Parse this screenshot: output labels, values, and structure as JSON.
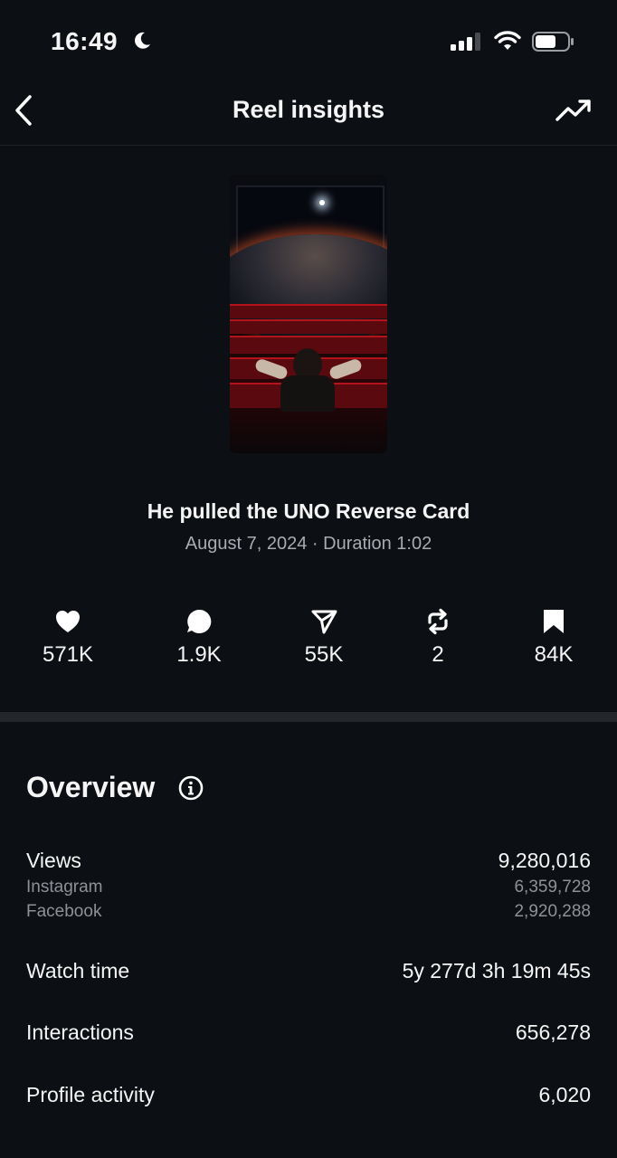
{
  "status_bar": {
    "time": "16:49"
  },
  "nav": {
    "title": "Reel insights"
  },
  "reel": {
    "title": "He pulled the UNO Reverse Card",
    "meta": "August 7, 2024 · Duration 1:02"
  },
  "stats": [
    {
      "icon": "heart-icon",
      "value": "571K"
    },
    {
      "icon": "comment-icon",
      "value": "1.9K"
    },
    {
      "icon": "share-icon",
      "value": "55K"
    },
    {
      "icon": "repost-icon",
      "value": "2"
    },
    {
      "icon": "bookmark-icon",
      "value": "84K"
    }
  ],
  "overview": {
    "title": "Overview",
    "views": {
      "label": "Views",
      "value": "9,280,016",
      "instagram_label": "Instagram",
      "instagram_value": "6,359,728",
      "facebook_label": "Facebook",
      "facebook_value": "2,920,288"
    },
    "watch_time": {
      "label": "Watch time",
      "value": "5y 277d 3h 19m 45s"
    },
    "interactions": {
      "label": "Interactions",
      "value": "656,278"
    },
    "profile_activity": {
      "label": "Profile activity",
      "value": "6,020"
    }
  }
}
